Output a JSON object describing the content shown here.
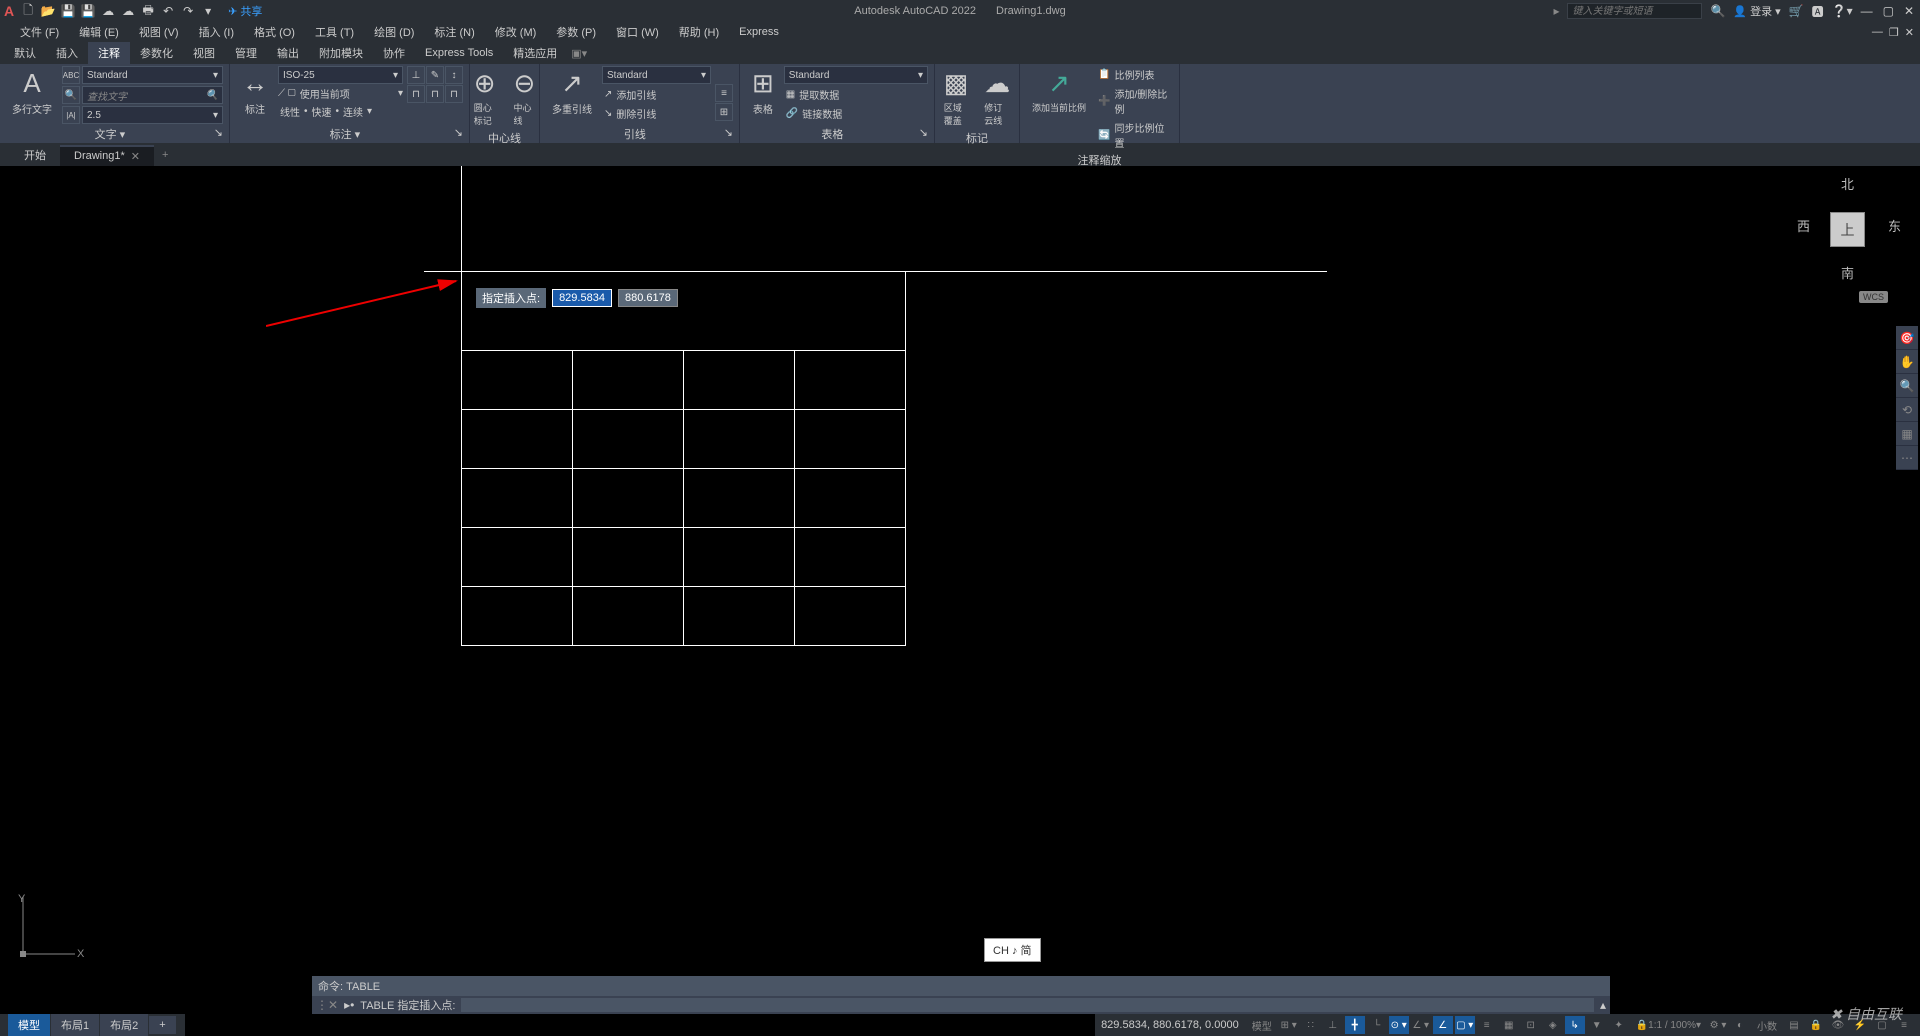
{
  "app": {
    "name": "Autodesk AutoCAD 2022",
    "file": "Drawing1.dwg",
    "share": "共享",
    "search_placeholder": "键入关键字或短语",
    "login": "登录"
  },
  "menu": {
    "items": [
      "文件 (F)",
      "编辑 (E)",
      "视图 (V)",
      "插入 (I)",
      "格式 (O)",
      "工具 (T)",
      "绘图 (D)",
      "标注 (N)",
      "修改 (M)",
      "参数 (P)",
      "窗口 (W)",
      "帮助 (H)",
      "Express"
    ]
  },
  "ribbon_tabs": [
    "默认",
    "插入",
    "注释",
    "参数化",
    "视图",
    "管理",
    "输出",
    "附加模块",
    "协作",
    "Express Tools",
    "精选应用"
  ],
  "active_ribbon_tab": "注释",
  "ribbon": {
    "text": {
      "big": "多行文字",
      "style": "Standard",
      "find_placeholder": "查找文字",
      "height": "2.5",
      "title": "文字"
    },
    "dim": {
      "big": "标注",
      "style": "ISO-25",
      "use_current": "使用当前项",
      "chain": [
        "线性",
        "快速",
        "连续"
      ],
      "title": "标注"
    },
    "center": {
      "btn1": "圆心标记",
      "btn2": "中心线",
      "title": "中心线"
    },
    "leader": {
      "big": "多重引线",
      "style": "Standard",
      "items": [
        "添加引线",
        "删除引线",
        "对齐",
        "合并"
      ],
      "title": "引线"
    },
    "table": {
      "big": "表格",
      "style": "Standard",
      "items": [
        "提取数据",
        "链接数据"
      ],
      "title": "表格"
    },
    "markup": {
      "btn1": "区域覆盖",
      "btn2": "修订云线",
      "title": "标记"
    },
    "add": {
      "big": "添加当前比例",
      "title": "注释缩放",
      "items": [
        "比例列表",
        "添加/删除比例",
        "同步比例位置"
      ]
    }
  },
  "file_tabs": {
    "start": "开始",
    "drawing": "Drawing1*"
  },
  "dynamic_input": {
    "label": "指定插入点:",
    "x": "829.5834",
    "y": "880.6178"
  },
  "viewcube": {
    "n": "北",
    "s": "南",
    "e": "东",
    "w": "西",
    "face": "上",
    "wcs": "WCS"
  },
  "ime": "CH ♪ 简",
  "command": {
    "history": "命令: TABLE",
    "prompt": "TABLE 指定插入点:"
  },
  "layout_tabs": [
    "模型",
    "布局1",
    "布局2"
  ],
  "status": {
    "coords": "829.5834, 880.6178, 0.0000",
    "model": "模型",
    "scale": "1:1 / 100%",
    "decimal": "小数"
  },
  "watermark": "自由互联",
  "ucs": {
    "x": "X",
    "y": "Y"
  }
}
